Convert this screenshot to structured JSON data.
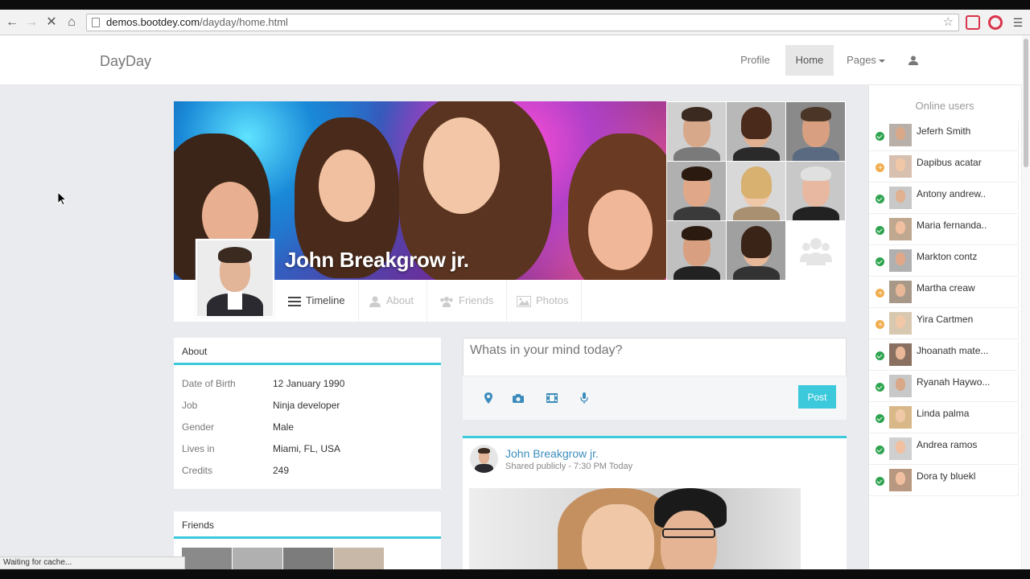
{
  "browser": {
    "url_host": "demos.bootdey.com",
    "url_path": "/dayday/home.html",
    "status_text": "Waiting for cache..."
  },
  "navbar": {
    "brand": "DayDay",
    "links": [
      {
        "label": "Profile"
      },
      {
        "label": "Home"
      },
      {
        "label": "Pages"
      }
    ]
  },
  "profile": {
    "name": "John Breakgrow jr.",
    "tabs": [
      {
        "label": "Timeline",
        "icon": "list-icon"
      },
      {
        "label": "About",
        "icon": "user-icon"
      },
      {
        "label": "Friends",
        "icon": "users-icon"
      },
      {
        "label": "Photos",
        "icon": "image-icon"
      }
    ]
  },
  "about": {
    "title": "About",
    "rows": [
      {
        "key": "Date of Birth",
        "value": "12 January 1990"
      },
      {
        "key": "Job",
        "value": "Ninja developer"
      },
      {
        "key": "Gender",
        "value": "Male"
      },
      {
        "key": "Lives in",
        "value": "Miami, FL, USA"
      },
      {
        "key": "Credits",
        "value": "249"
      }
    ]
  },
  "friends_card": {
    "title": "Friends"
  },
  "status": {
    "placeholder": "Whats in your mind today?",
    "post_label": "Post",
    "tools": [
      "map-marker-icon",
      "camera-icon",
      "film-icon",
      "microphone-icon"
    ]
  },
  "feed": {
    "author": "John Breakgrow jr.",
    "meta": "Shared publicly - 7:30 PM Today"
  },
  "online": {
    "title": "Online users",
    "users": [
      {
        "name": "Jeferh Smith",
        "status": "online"
      },
      {
        "name": "Dapibus acatar",
        "status": "away"
      },
      {
        "name": "Antony andrew..",
        "status": "online"
      },
      {
        "name": "Maria fernanda..",
        "status": "online"
      },
      {
        "name": "Markton contz",
        "status": "online"
      },
      {
        "name": "Martha creaw",
        "status": "away"
      },
      {
        "name": "Yira Cartmen",
        "status": "away"
      },
      {
        "name": "Jhoanath mate...",
        "status": "online"
      },
      {
        "name": "Ryanah Haywo...",
        "status": "online"
      },
      {
        "name": "Linda palma",
        "status": "online"
      },
      {
        "name": "Andrea ramos",
        "status": "online"
      },
      {
        "name": "Dora ty bluekl",
        "status": "online"
      }
    ]
  },
  "colors": {
    "accent": "#3bc9db",
    "link": "#3c8dbc",
    "online": "#2ea44f",
    "away": "#f0ad4e"
  }
}
